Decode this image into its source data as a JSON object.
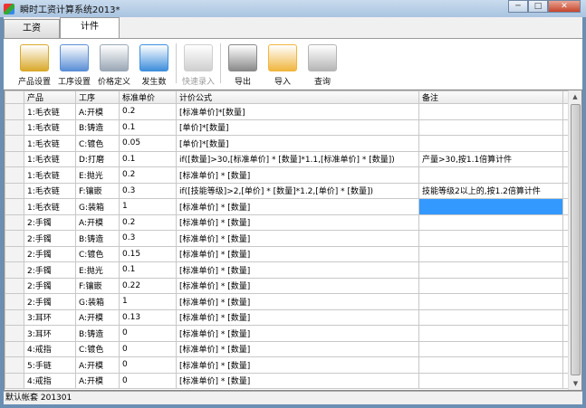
{
  "window": {
    "title": "瞬时工资计算系统2013*",
    "min": "─",
    "max": "□",
    "close": "✕"
  },
  "tabs": [
    {
      "label": "工资"
    },
    {
      "label": "计件"
    }
  ],
  "toolbar": [
    {
      "label": "产品设置",
      "icon": "box-icon",
      "color": "#d9a92c",
      "disabled": false
    },
    {
      "label": "工序设置",
      "icon": "grid-window-icon",
      "color": "#5b8fd6",
      "disabled": false
    },
    {
      "label": "价格定义",
      "icon": "calculator-icon",
      "color": "#9aa7b5",
      "disabled": false
    },
    {
      "label": "发生数",
      "icon": "notebook-pencil-icon",
      "color": "#3f8fdc",
      "disabled": false
    },
    {
      "label": "快速录入",
      "icon": "magic-wand-icon",
      "color": "#cfcfcf",
      "disabled": true
    },
    {
      "label": "导出",
      "icon": "chart-export-icon",
      "color": "#8a8a8a",
      "disabled": false
    },
    {
      "label": "导入",
      "icon": "folder-import-icon",
      "color": "#f0b640",
      "disabled": false
    },
    {
      "label": "查询",
      "icon": "magnifier-icon",
      "color": "#b5b5b5",
      "disabled": false
    }
  ],
  "grid": {
    "columns": [
      "产品",
      "工序",
      "标准单价",
      "计价公式",
      "备注"
    ],
    "rows": [
      [
        "1:毛衣链",
        "A:开模",
        "0.2",
        "[标准单价]*[数量]",
        ""
      ],
      [
        "1:毛衣链",
        "B:铸造",
        "0.1",
        "[单价]*[数量]",
        ""
      ],
      [
        "1:毛衣链",
        "C:镀色",
        "0.05",
        "[单价]*[数量]",
        ""
      ],
      [
        "1:毛衣链",
        "D:打磨",
        "0.1",
        "if([数量]>30,[标准单价] * [数量]*1.1,[标准单价] * [数量])",
        "产量>30,按1.1倍算计件"
      ],
      [
        "1:毛衣链",
        "E:抛光",
        "0.2",
        "[标准单价] * [数量]",
        ""
      ],
      [
        "1:毛衣链",
        "F:镶嵌",
        "0.3",
        "if([技能等级]>2,[单价] * [数量]*1.2,[单价] * [数量])",
        "技能等级2以上的,按1.2倍算计件"
      ],
      [
        "1:毛衣链",
        "G:装箱",
        "1",
        "[标准单价] * [数量]",
        ""
      ],
      [
        "2:手镯",
        "A:开模",
        "0.2",
        "[标准单价] * [数量]",
        ""
      ],
      [
        "2:手镯",
        "B:铸造",
        "0.3",
        "[标准单价] * [数量]",
        ""
      ],
      [
        "2:手镯",
        "C:镀色",
        "0.15",
        "[标准单价] * [数量]",
        ""
      ],
      [
        "2:手镯",
        "E:抛光",
        "0.1",
        "[标准单价] * [数量]",
        ""
      ],
      [
        "2:手镯",
        "F:镶嵌",
        "0.22",
        "[标准单价] * [数量]",
        ""
      ],
      [
        "2:手镯",
        "G:装箱",
        "1",
        "[标准单价] * [数量]",
        ""
      ],
      [
        "3:耳环",
        "A:开模",
        "0.13",
        "[标准单价] * [数量]",
        ""
      ],
      [
        "3:耳环",
        "B:铸造",
        "0",
        "[标准单价] * [数量]",
        ""
      ],
      [
        "4:戒指",
        "C:镀色",
        "0",
        "[标准单价] * [数量]",
        ""
      ],
      [
        "5:手链",
        "A:开模",
        "0",
        "[标准单价] * [数量]",
        ""
      ],
      [
        "4:戒指",
        "A:开模",
        "0",
        "[标准单价] * [数量]",
        ""
      ]
    ],
    "selected_row": 6,
    "selected_col": 4,
    "selection_color": "#3399ff"
  },
  "status": {
    "text": "默认帐套 201301"
  }
}
